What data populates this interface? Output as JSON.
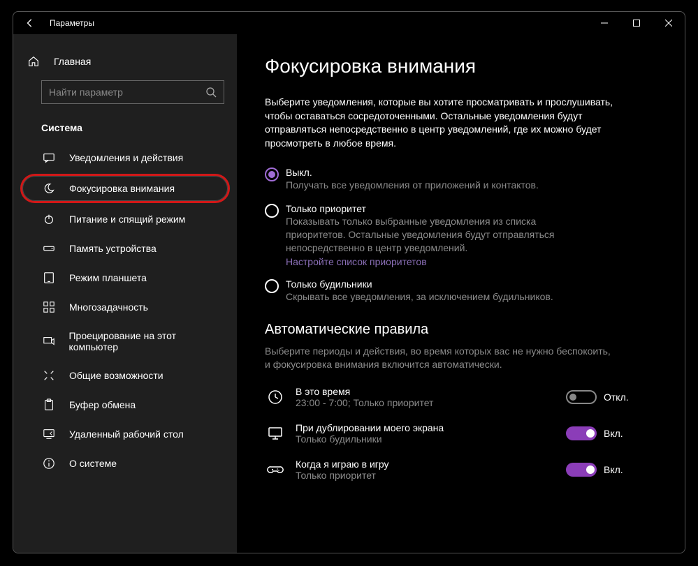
{
  "titlebar": {
    "title": "Параметры"
  },
  "sidebar": {
    "home": "Главная",
    "search_placeholder": "Найти параметр",
    "section": "Система",
    "items": [
      {
        "label": "Уведомления и действия"
      },
      {
        "label": "Фокусировка внимания"
      },
      {
        "label": "Питание и спящий режим"
      },
      {
        "label": "Память устройства"
      },
      {
        "label": "Режим планшета"
      },
      {
        "label": "Многозадачность"
      },
      {
        "label": "Проецирование на этот компьютер"
      },
      {
        "label": "Общие возможности"
      },
      {
        "label": "Буфер обмена"
      },
      {
        "label": "Удаленный рабочий стол"
      },
      {
        "label": "О системе"
      }
    ]
  },
  "main": {
    "title": "Фокусировка внимания",
    "description": "Выберите уведомления, которые вы хотите просматривать и прослушивать, чтобы оставаться сосредоточенными. Остальные уведомления будут отправляться непосредственно в центр уведомлений, где их можно будет просмотреть в любое время.",
    "radios": {
      "off": {
        "label": "Выкл.",
        "sub": "Получать все уведомления от приложений и контактов."
      },
      "priority": {
        "label": "Только приоритет",
        "sub": "Показывать только выбранные уведомления из списка приоритетов. Остальные уведомления будут отправляться непосредственно в центр уведомлений.",
        "link": "Настройте список приоритетов"
      },
      "alarms": {
        "label": "Только будильники",
        "sub": "Скрывать все уведомления, за исключением будильников."
      }
    },
    "auto": {
      "heading": "Автоматические правила",
      "desc": "Выберите периоды и действия, во время которых вас не нужно беспокоить, и фокусировка внимания включится автоматически.",
      "rules": [
        {
          "title": "В это время",
          "sub": "23:00 - 7:00; Только приоритет",
          "toggle": "Откл.",
          "on": false
        },
        {
          "title": "При дублировании моего экрана",
          "sub": "Только будильники",
          "toggle": "Вкл.",
          "on": true
        },
        {
          "title": "Когда я играю в игру",
          "sub": "Только приоритет",
          "toggle": "Вкл.",
          "on": true
        }
      ]
    }
  }
}
